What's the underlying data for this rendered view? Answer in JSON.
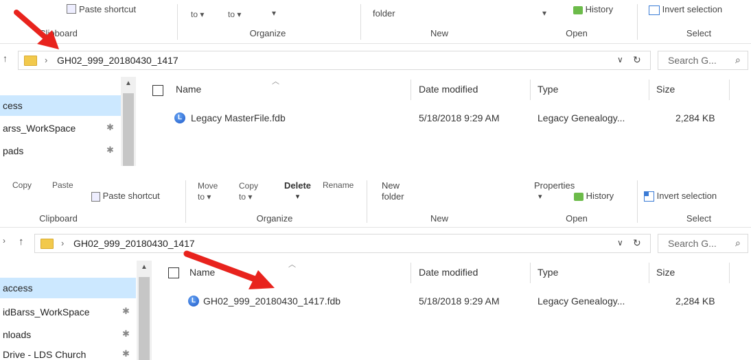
{
  "top": {
    "ribbon": {
      "paste_shortcut": "Paste shortcut",
      "move_to": "to",
      "copy_to": "to",
      "new_folder": "folder",
      "history": "History",
      "invert_selection": "Invert selection"
    },
    "groups": {
      "clipboard": "Clipboard",
      "organize": "Organize",
      "new": "New",
      "open": "Open",
      "select": "Select"
    },
    "address": {
      "path": "GH02_999_20180430_1417",
      "search_placeholder": "Search G...",
      "chevron": "›"
    },
    "nav": [
      {
        "label": "cess",
        "pinned": false
      },
      {
        "label": "arss_WorkSpace",
        "pinned": true
      },
      {
        "label": "pads",
        "pinned": true
      }
    ],
    "columns": {
      "name": "Name",
      "date": "Date modified",
      "type": "Type",
      "size": "Size"
    },
    "file": {
      "name": "Legacy MasterFile.fdb",
      "date": "5/18/2018 9:29 AM",
      "type": "Legacy Genealogy...",
      "size": "2,284 KB"
    }
  },
  "bottom": {
    "ribbon": {
      "copy": "Copy",
      "paste": "Paste",
      "paste_shortcut": "Paste shortcut",
      "move": "Move",
      "move_to": "to",
      "copy2": "Copy",
      "copy_to": "to",
      "delete": "Delete",
      "rename": "Rename",
      "new": "New",
      "folder": "folder",
      "properties": "Properties",
      "history": "History",
      "invert_selection": "Invert selection"
    },
    "groups": {
      "clipboard": "Clipboard",
      "organize": "Organize",
      "new": "New",
      "open": "Open",
      "select": "Select"
    },
    "address": {
      "path": "GH02_999_20180430_1417",
      "search_placeholder": "Search G...",
      "chevron": "›"
    },
    "nav": [
      {
        "label": "access",
        "pinned": false
      },
      {
        "label": "idBarss_WorkSpace",
        "pinned": true
      },
      {
        "label": "nloads",
        "pinned": true
      },
      {
        "label": "Drive - LDS Church",
        "pinned": true
      }
    ],
    "columns": {
      "name": "Name",
      "date": "Date modified",
      "type": "Type",
      "size": "Size"
    },
    "file": {
      "name": "GH02_999_20180430_1417.fdb",
      "date": "5/18/2018 9:29 AM",
      "type": "Legacy Genealogy...",
      "size": "2,284 KB"
    }
  },
  "icons": {
    "pin": "pin-icon",
    "refresh": "refresh-icon",
    "search": "search-icon",
    "up": "up-arrow-icon",
    "db": "database-file-icon",
    "folder": "folder-icon",
    "annotation": "red-arrow-icon"
  },
  "colors": {
    "selection": "#cce8ff",
    "folder": "#f2c94c",
    "annotation": "#e8231d"
  }
}
